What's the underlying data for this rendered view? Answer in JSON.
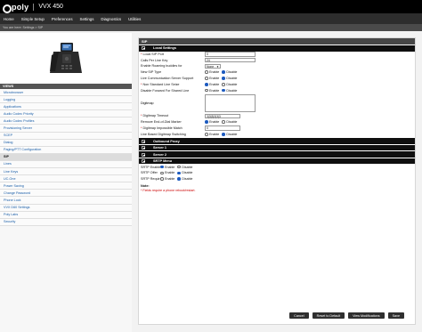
{
  "header": {
    "logo": "poly",
    "product": "VVX 450"
  },
  "nav": {
    "items": [
      "Home",
      "Simple Setup",
      "Preferences",
      "Settings",
      "Diagnostics",
      "Utilities"
    ]
  },
  "breadcrumb": "You are here: Settings > SIP",
  "sidebar": {
    "views_label": "VIEWS",
    "items": [
      "Microbrowser",
      "Logging",
      "Applications",
      "Audio Codec Priority",
      "Audio Codec Profiles",
      "Provisioning Server",
      "SCEP",
      "Dialog",
      "Paging/PTT Configuration",
      "SIP",
      "Lines",
      "Line Keys",
      "UC-One",
      "Power Saving",
      "Change Password",
      "Phone Lock",
      "VVX D60 Settings",
      "Poly Labs",
      "Security"
    ],
    "active_item": "SIP"
  },
  "main": {
    "title": "SIP",
    "sections": {
      "local": "Local Settings",
      "outbound": "Outbound Proxy",
      "server1": "Server 1",
      "server2": "Server 2",
      "srtp": "SRTP Menu"
    },
    "fields": {
      "local_sip_port": {
        "label": "Local SIP Port",
        "value": "0"
      },
      "calls_per_line_key": {
        "label": "Calls Per Line Key",
        "value": "24"
      },
      "roaming_buddies": {
        "label": "Enable Roaming buddies for",
        "value": "None"
      },
      "new_sip_type": {
        "label": "New SIP Type",
        "opt1": "Enable",
        "opt2": "Disable"
      },
      "lcs_support": {
        "label": "Live Communication Server Support",
        "opt1": "Enable",
        "opt2": "Disable"
      },
      "non_standard_seize": {
        "label": "Non Standard Line Seize",
        "opt1": "Enable",
        "opt2": "Disable"
      },
      "disable_forward": {
        "label": "Disable Forward For Shared Line",
        "opt1": "Enable",
        "opt2": "Disable"
      },
      "digitmap": {
        "label": "Digitmap"
      },
      "digitmap_timeout": {
        "label": "Digitmap Timeout",
        "value": "3|3|3|3|3|3"
      },
      "remove_eod": {
        "label": "Remove End-of-Dial Marker",
        "opt1": "Enable",
        "opt2": "Disable"
      },
      "impossible_match": {
        "label": "Digitmap Impossible Match",
        "value": "0"
      },
      "line_based_switching": {
        "label": "Line Based Digitmap Switching",
        "opt1": "Enable",
        "opt2": "Disable"
      },
      "srtp_enable": {
        "label": "SRTP Enable",
        "opt1": "Enable",
        "opt2": "Disable"
      },
      "srtp_offer": {
        "label": "SRTP Offer",
        "opt1": "Enable",
        "opt2": "Disable"
      },
      "srtp_require": {
        "label": "SRTP Require",
        "opt1": "Enable",
        "opt2": "Disable"
      }
    },
    "note_title": "Note:",
    "note_text": "* Fields require a phone reboot/restart.",
    "buttons": {
      "cancel": "Cancel",
      "reset": "Reset to Default",
      "view_mods": "View Modifications",
      "save": "Save"
    }
  }
}
